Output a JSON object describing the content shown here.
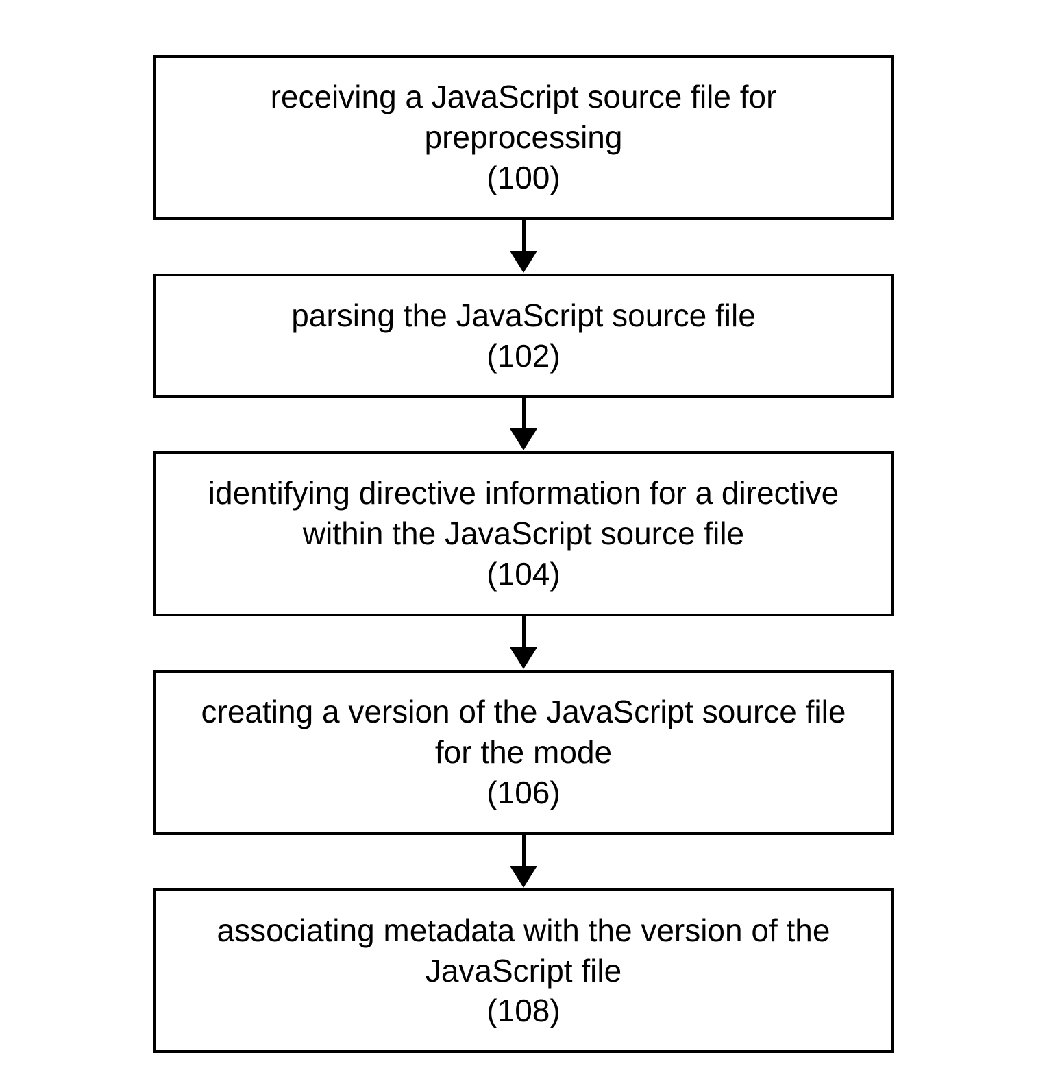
{
  "steps": [
    {
      "text": "receiving a JavaScript source file for preprocessing",
      "number": "(100)"
    },
    {
      "text": "parsing the JavaScript source file",
      "number": "(102)"
    },
    {
      "text": "identifying directive information for a directive within the JavaScript source file",
      "number": "(104)"
    },
    {
      "text": "creating a version of the JavaScript source file for the mode",
      "number": "(106)"
    },
    {
      "text": "associating metadata with the version of the JavaScript file",
      "number": "(108)"
    }
  ]
}
